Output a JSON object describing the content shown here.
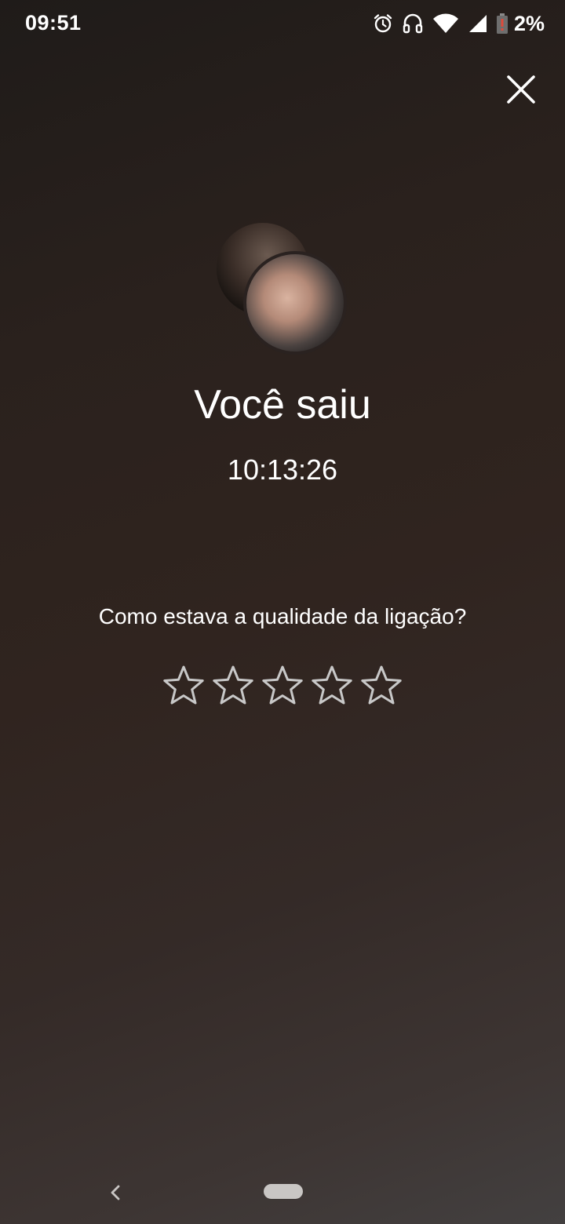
{
  "status_bar": {
    "time": "09:51",
    "battery_percent": "2%",
    "icons": [
      "alarm-icon",
      "headset-icon",
      "wifi-icon",
      "signal-icon",
      "battery-icon"
    ]
  },
  "call_end": {
    "title": "Você saiu",
    "duration": "10:13:26"
  },
  "rating": {
    "question": "Como estava a qualidade da ligação?",
    "stars_total": 5,
    "stars_selected": 0
  },
  "colors": {
    "text": "#ffffff",
    "star_outline": "#c8c8c8",
    "battery_warning": "#e04a3a"
  }
}
